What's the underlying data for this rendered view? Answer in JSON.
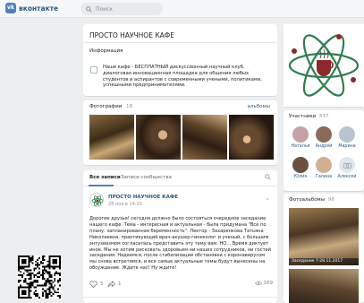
{
  "header": {
    "logo_text": "вконтакте",
    "logo_mark": "vk",
    "search_placeholder": "Поиск"
  },
  "group": {
    "title": "ПРОСТО НАУЧНОЕ КАФЕ",
    "info_heading": "Информация",
    "info_text": "Наше кафе - БЕСПЛАТНЫЙ дискуссионный научный клуб, диалоговая инновационная площадка для общения любых студентов и аспирантов с современными учеными, политиками, успешными предпринимателями."
  },
  "photos": {
    "label": "Фотографии",
    "count": "18",
    "all_link": "альбомы"
  },
  "wall": {
    "tabs": [
      "Все записи",
      "Записи сообщества"
    ],
    "post": {
      "author": "ПРОСТО НАУЧНОЕ КАФЕ",
      "date": "28 ноя в 14:15",
      "text": "Дорогие друзья! сегодня должно было состояться очередное заседание нашего кафе. Тема - интересная и актуальная - была придумана \"Все по плану: запланированная беременность\". Лектор - Захаренкова Татьяна Николаевна, практикующий врач-акушер-гинеколог и ученый, с большим энтузиазмом согласилась представить эту тему вам. НО... Время диктует иное. Мы не хотим рисковать здоровьем ни наших сотрудников, ни гостей заседания. Надеемся, после стабилизации обстановки с коронавирусом мы снова встретимся, и все самые актуальные темы будут вынесены на обсуждение. Ждите нас! Ну ждите!",
      "likes": "5",
      "shares": "1",
      "views": "169"
    }
  },
  "members": {
    "label": "Участники",
    "count": "837",
    "people": [
      "Наталья",
      "Андрей",
      "Марина",
      "Юлия",
      "Галина",
      "Алексей"
    ],
    "colors": [
      "#c9a0a8",
      "#8a6a5a",
      "#b8c4d0",
      "#6a5040",
      "#d0b090",
      "#e0e6ee"
    ]
  },
  "albums": {
    "label": "Фотоальбомы",
    "count": "98",
    "album_title": "Заседание 7-28.11.2017"
  }
}
